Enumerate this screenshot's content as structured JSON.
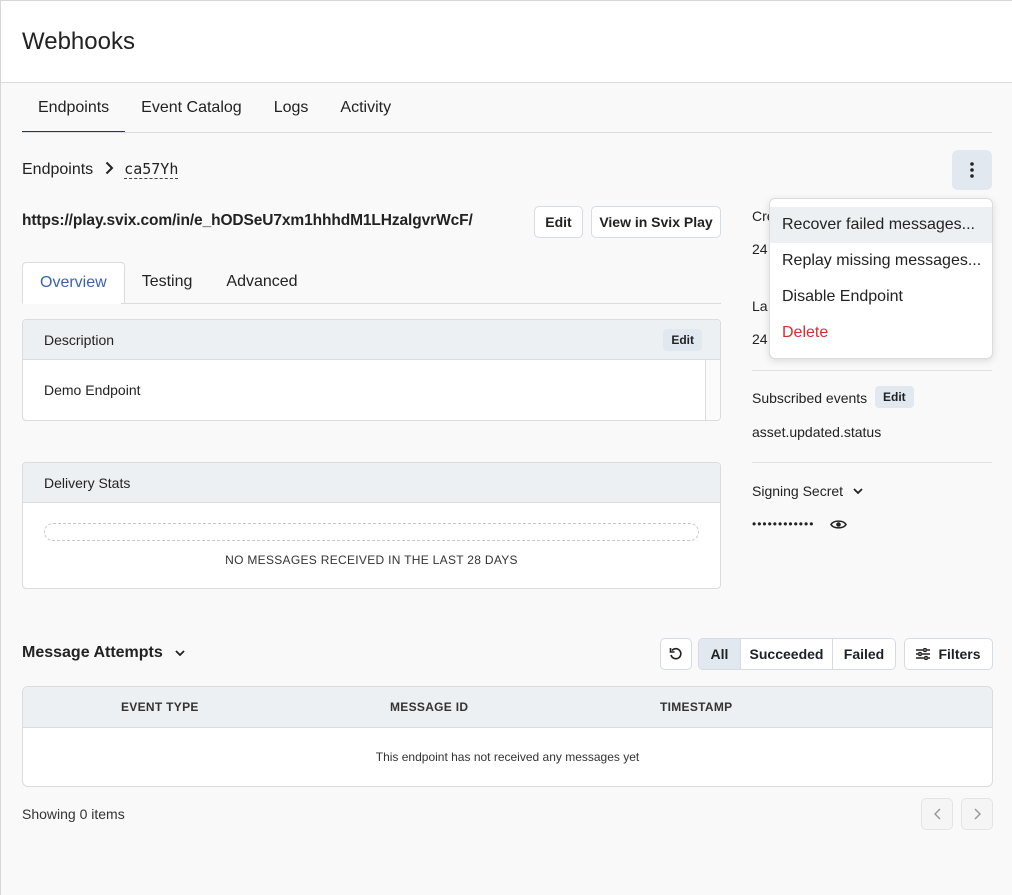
{
  "header": {
    "title": "Webhooks"
  },
  "tabs": [
    {
      "label": "Endpoints",
      "active": true
    },
    {
      "label": "Event Catalog"
    },
    {
      "label": "Logs"
    },
    {
      "label": "Activity"
    }
  ],
  "breadcrumb": {
    "root": "Endpoints",
    "current": "ca57Yh"
  },
  "endpoint": {
    "url": "https://play.svix.com/in/e_hODSeU7xm1hhhdM1LHzalgvrWcF/",
    "edit_label": "Edit",
    "play_label": "View in Svix Play"
  },
  "subtabs": [
    {
      "label": "Overview",
      "active": true
    },
    {
      "label": "Testing"
    },
    {
      "label": "Advanced"
    }
  ],
  "description_card": {
    "title": "Description",
    "edit_label": "Edit",
    "body": "Demo Endpoint"
  },
  "stats_card": {
    "title": "Delivery Stats",
    "empty": "NO MESSAGES RECEIVED IN THE LAST 28 DAYS"
  },
  "side": {
    "created_label": "Cre",
    "created_value": "24",
    "last_label": "La",
    "last_value": "24",
    "subscribed_label": "Subscribed events",
    "subscribed_edit": "Edit",
    "subscribed_value": "asset.updated.status",
    "secret_label": "Signing Secret",
    "secret_value": "••••••••••••"
  },
  "menu": {
    "items": [
      {
        "label": "Recover failed messages..."
      },
      {
        "label": "Replay missing messages..."
      },
      {
        "label": "Disable Endpoint"
      },
      {
        "label": "Delete"
      }
    ]
  },
  "attempts": {
    "title": "Message Attempts",
    "filter_all": "All",
    "filter_succeeded": "Succeeded",
    "filter_failed": "Failed",
    "filters_label": "Filters",
    "columns": [
      "EVENT TYPE",
      "MESSAGE ID",
      "TIMESTAMP"
    ],
    "empty": "This endpoint has not received any messages yet",
    "showing": "Showing 0 items"
  },
  "colors": {
    "accent": "#3b64a8",
    "danger": "#d32f2f",
    "chip": "#e2e8f0"
  }
}
